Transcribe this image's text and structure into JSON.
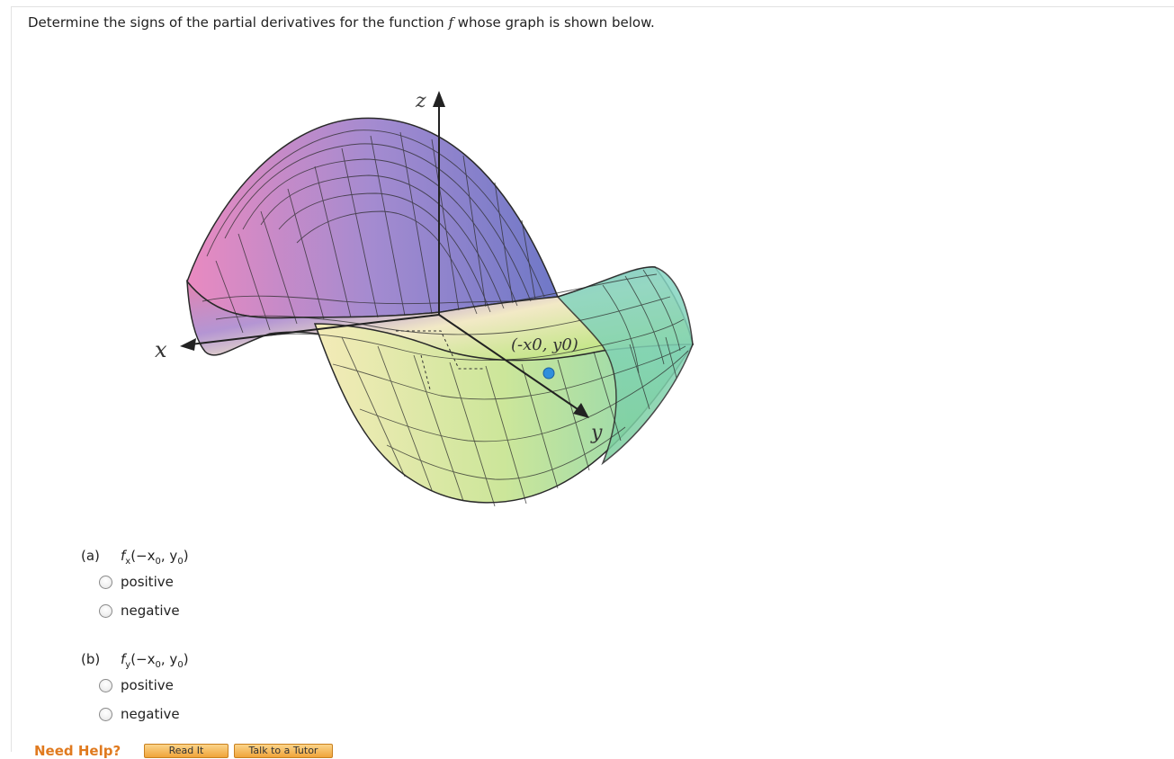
{
  "question": {
    "prefix": "Determine the signs of the partial derivatives for the function ",
    "func": "f",
    "suffix": " whose graph is shown below."
  },
  "figure": {
    "z_label": "z",
    "x_label": "x",
    "y_label": "y",
    "point_label": "(-x0, y0)",
    "colors": {
      "axis": "#222222",
      "point": "#2f8fdc",
      "mesh_line": "#2a2a2a"
    }
  },
  "parts": [
    {
      "label": "(a)",
      "f": "f",
      "sub": "x",
      "args": "(−x",
      "args_sub": "0",
      "args_end": ", y",
      "args_end_sub": "0",
      "close": ")",
      "options": [
        "positive",
        "negative"
      ]
    },
    {
      "label": "(b)",
      "f": "f",
      "sub": "y",
      "args": "(−x",
      "args_sub": "0",
      "args_end": ", y",
      "args_end_sub": "0",
      "close": ")",
      "options": [
        "positive",
        "negative"
      ]
    }
  ],
  "help": {
    "label": "Need Help?",
    "buttons": [
      "Read It",
      "Talk to a Tutor"
    ]
  }
}
